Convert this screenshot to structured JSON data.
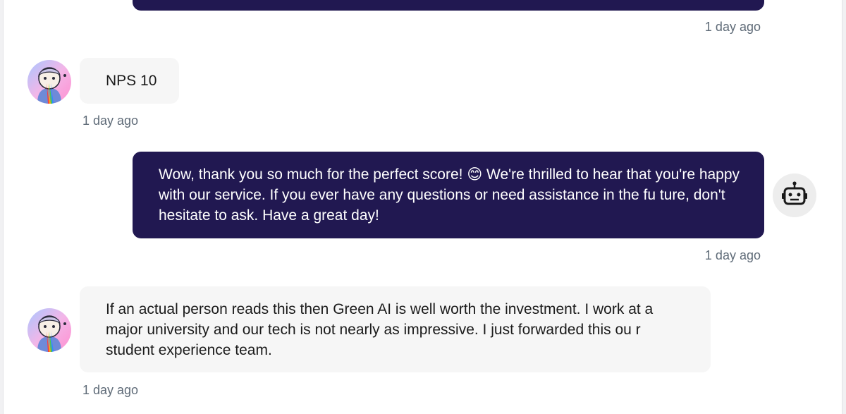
{
  "messages": [
    {
      "role": "bot",
      "text": "",
      "timestamp": "1 day ago"
    },
    {
      "role": "user",
      "text": "NPS 10",
      "timestamp": "1 day ago"
    },
    {
      "role": "bot",
      "text": "Wow, thank you so much for the perfect score! 😊 We're thrilled to hear that you're happy with our service. If you ever have any questions or need assistance in the fu ture, don't hesitate to ask. Have a great day!",
      "timestamp": "1 day ago"
    },
    {
      "role": "user",
      "text": "If an actual person reads this then Green AI is well worth the investment. I work at a major university and our tech is not nearly as impressive. I just forwarded this ou r student experience team.",
      "timestamp": "1 day ago"
    }
  ],
  "icons": {
    "user_avatar": "user-avatar-icon",
    "bot_avatar": "robot-icon"
  },
  "colors": {
    "bot_bubble": "#211851",
    "user_bubble": "#f6f6f6",
    "timestamp": "#5f6b78"
  }
}
